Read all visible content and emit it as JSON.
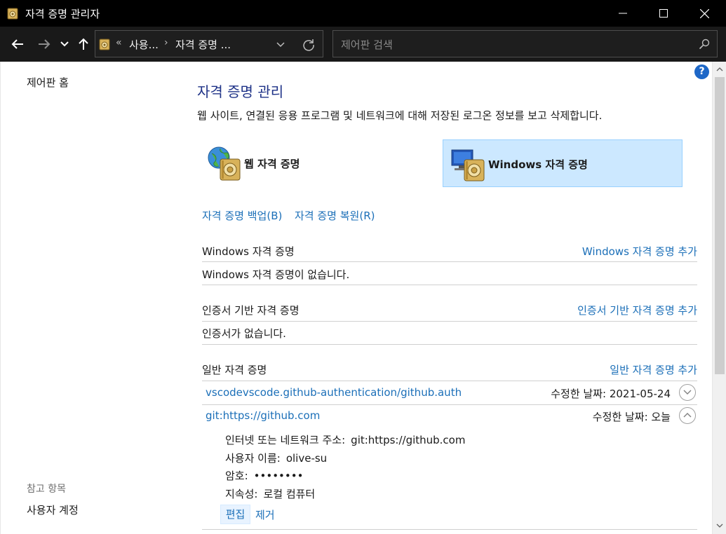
{
  "window": {
    "title": "자격 증명 관리자"
  },
  "address_bar": {
    "overflow": "«",
    "crumbs": [
      "사용...",
      "자격 증명 ..."
    ],
    "separator": "›"
  },
  "search": {
    "placeholder": "제어판 검색"
  },
  "left_pane": {
    "home": "제어판 홈",
    "see_also_heading": "참고 항목",
    "see_also_items": [
      "사용자 계정"
    ]
  },
  "main": {
    "help": "?",
    "title": "자격 증명 관리",
    "description": "웹 사이트, 연결된 응용 프로그램 및 네트워크에 대해 저장된 로그온 정보를 보고 삭제합니다.",
    "tiles": {
      "web": "웹 자격 증명",
      "windows": "Windows 자격 증명",
      "selected": "windows"
    },
    "backup_link": "자격 증명 백업(B)",
    "restore_link": "자격 증명 복원(R)",
    "sections": {
      "windows": {
        "heading": "Windows 자격 증명",
        "add_link": "Windows 자격 증명 추가",
        "empty_text": "Windows 자격 증명이 없습니다."
      },
      "certificate": {
        "heading": "인증서 기반 자격 증명",
        "add_link": "인증서 기반 자격 증명 추가",
        "empty_text": "인증서가 없습니다."
      },
      "generic": {
        "heading": "일반 자격 증명",
        "add_link": "일반 자격 증명 추가",
        "entries": [
          {
            "name": "vscodevscode.github-authentication/github.auth",
            "modified": "수정한 날짜:  2021-05-24",
            "expanded": false
          },
          {
            "name": "git:https://github.com",
            "modified": "수정한 날짜:  오늘",
            "expanded": true,
            "details": {
              "address_label": "인터넷 또는 네트워크 주소:",
              "address_value": "git:https://github.com",
              "username_label": "사용자 이름:",
              "username_value": "olive-su",
              "password_label": "암호:",
              "password_value": "••••••••",
              "persistence_label": "지속성:",
              "persistence_value": "로컬 컴퓨터"
            },
            "actions": {
              "edit": "편집",
              "remove": "제거"
            }
          }
        ]
      }
    }
  },
  "colors": {
    "titlebar": "#000000",
    "navbar": "#191919",
    "link": "#1b6fb8",
    "title": "#1e3287",
    "selected_tile": "#cce8ff"
  },
  "icons": {
    "app": "credential-vault-icon",
    "back": "arrow-left-icon",
    "forward": "arrow-right-icon",
    "recent": "chevron-down-icon",
    "up": "arrow-up-icon",
    "refresh": "refresh-icon",
    "search": "search-icon",
    "web_tile": "globe-vault-icon",
    "windows_tile": "monitor-vault-icon"
  }
}
